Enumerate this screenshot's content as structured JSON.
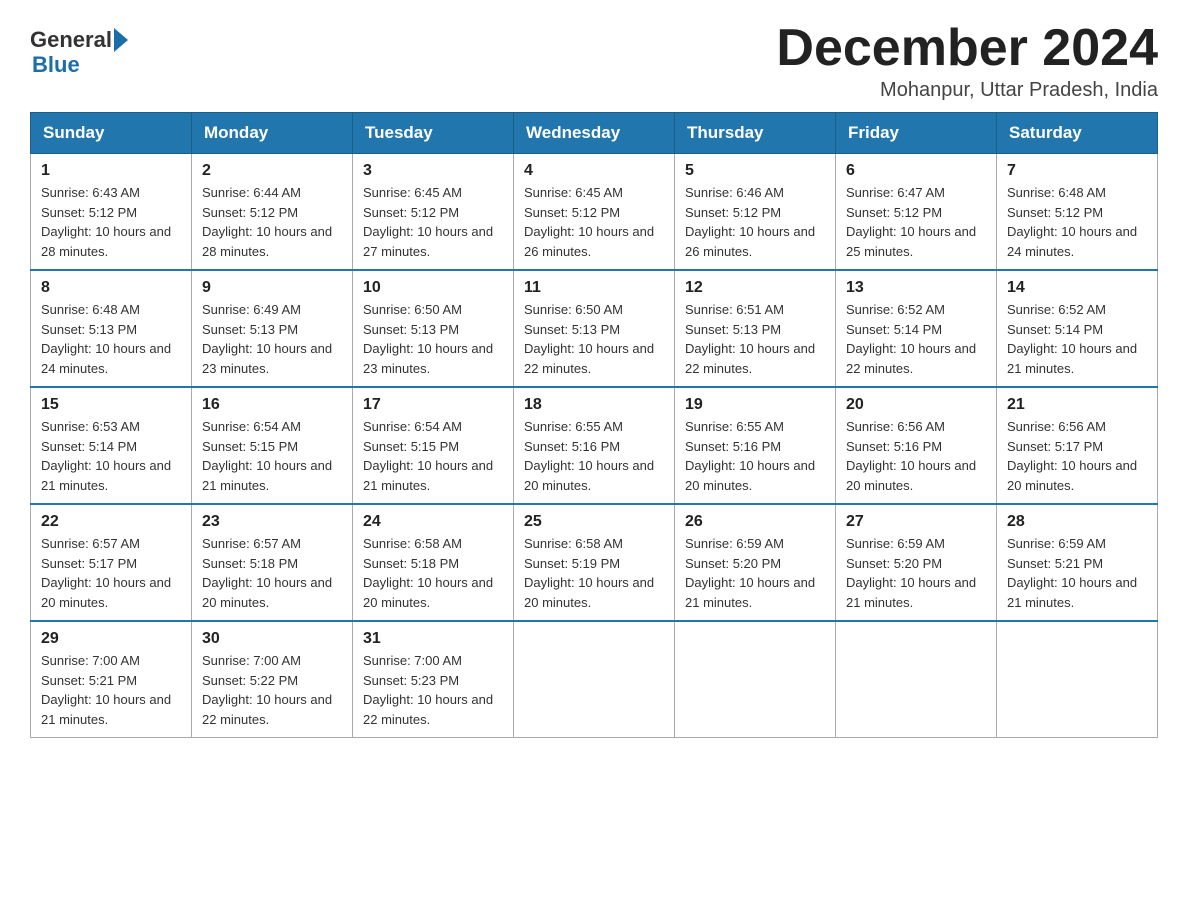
{
  "header": {
    "logo": {
      "general_text": "General",
      "blue_text": "Blue"
    },
    "title": "December 2024",
    "location": "Mohanpur, Uttar Pradesh, India"
  },
  "calendar": {
    "days_of_week": [
      "Sunday",
      "Monday",
      "Tuesday",
      "Wednesday",
      "Thursday",
      "Friday",
      "Saturday"
    ],
    "weeks": [
      [
        {
          "day": "1",
          "sunrise": "6:43 AM",
          "sunset": "5:12 PM",
          "daylight": "10 hours and 28 minutes."
        },
        {
          "day": "2",
          "sunrise": "6:44 AM",
          "sunset": "5:12 PM",
          "daylight": "10 hours and 28 minutes."
        },
        {
          "day": "3",
          "sunrise": "6:45 AM",
          "sunset": "5:12 PM",
          "daylight": "10 hours and 27 minutes."
        },
        {
          "day": "4",
          "sunrise": "6:45 AM",
          "sunset": "5:12 PM",
          "daylight": "10 hours and 26 minutes."
        },
        {
          "day": "5",
          "sunrise": "6:46 AM",
          "sunset": "5:12 PM",
          "daylight": "10 hours and 26 minutes."
        },
        {
          "day": "6",
          "sunrise": "6:47 AM",
          "sunset": "5:12 PM",
          "daylight": "10 hours and 25 minutes."
        },
        {
          "day": "7",
          "sunrise": "6:48 AM",
          "sunset": "5:12 PM",
          "daylight": "10 hours and 24 minutes."
        }
      ],
      [
        {
          "day": "8",
          "sunrise": "6:48 AM",
          "sunset": "5:13 PM",
          "daylight": "10 hours and 24 minutes."
        },
        {
          "day": "9",
          "sunrise": "6:49 AM",
          "sunset": "5:13 PM",
          "daylight": "10 hours and 23 minutes."
        },
        {
          "day": "10",
          "sunrise": "6:50 AM",
          "sunset": "5:13 PM",
          "daylight": "10 hours and 23 minutes."
        },
        {
          "day": "11",
          "sunrise": "6:50 AM",
          "sunset": "5:13 PM",
          "daylight": "10 hours and 22 minutes."
        },
        {
          "day": "12",
          "sunrise": "6:51 AM",
          "sunset": "5:13 PM",
          "daylight": "10 hours and 22 minutes."
        },
        {
          "day": "13",
          "sunrise": "6:52 AM",
          "sunset": "5:14 PM",
          "daylight": "10 hours and 22 minutes."
        },
        {
          "day": "14",
          "sunrise": "6:52 AM",
          "sunset": "5:14 PM",
          "daylight": "10 hours and 21 minutes."
        }
      ],
      [
        {
          "day": "15",
          "sunrise": "6:53 AM",
          "sunset": "5:14 PM",
          "daylight": "10 hours and 21 minutes."
        },
        {
          "day": "16",
          "sunrise": "6:54 AM",
          "sunset": "5:15 PM",
          "daylight": "10 hours and 21 minutes."
        },
        {
          "day": "17",
          "sunrise": "6:54 AM",
          "sunset": "5:15 PM",
          "daylight": "10 hours and 21 minutes."
        },
        {
          "day": "18",
          "sunrise": "6:55 AM",
          "sunset": "5:16 PM",
          "daylight": "10 hours and 20 minutes."
        },
        {
          "day": "19",
          "sunrise": "6:55 AM",
          "sunset": "5:16 PM",
          "daylight": "10 hours and 20 minutes."
        },
        {
          "day": "20",
          "sunrise": "6:56 AM",
          "sunset": "5:16 PM",
          "daylight": "10 hours and 20 minutes."
        },
        {
          "day": "21",
          "sunrise": "6:56 AM",
          "sunset": "5:17 PM",
          "daylight": "10 hours and 20 minutes."
        }
      ],
      [
        {
          "day": "22",
          "sunrise": "6:57 AM",
          "sunset": "5:17 PM",
          "daylight": "10 hours and 20 minutes."
        },
        {
          "day": "23",
          "sunrise": "6:57 AM",
          "sunset": "5:18 PM",
          "daylight": "10 hours and 20 minutes."
        },
        {
          "day": "24",
          "sunrise": "6:58 AM",
          "sunset": "5:18 PM",
          "daylight": "10 hours and 20 minutes."
        },
        {
          "day": "25",
          "sunrise": "6:58 AM",
          "sunset": "5:19 PM",
          "daylight": "10 hours and 20 minutes."
        },
        {
          "day": "26",
          "sunrise": "6:59 AM",
          "sunset": "5:20 PM",
          "daylight": "10 hours and 21 minutes."
        },
        {
          "day": "27",
          "sunrise": "6:59 AM",
          "sunset": "5:20 PM",
          "daylight": "10 hours and 21 minutes."
        },
        {
          "day": "28",
          "sunrise": "6:59 AM",
          "sunset": "5:21 PM",
          "daylight": "10 hours and 21 minutes."
        }
      ],
      [
        {
          "day": "29",
          "sunrise": "7:00 AM",
          "sunset": "5:21 PM",
          "daylight": "10 hours and 21 minutes."
        },
        {
          "day": "30",
          "sunrise": "7:00 AM",
          "sunset": "5:22 PM",
          "daylight": "10 hours and 22 minutes."
        },
        {
          "day": "31",
          "sunrise": "7:00 AM",
          "sunset": "5:23 PM",
          "daylight": "10 hours and 22 minutes."
        },
        null,
        null,
        null,
        null
      ]
    ]
  }
}
